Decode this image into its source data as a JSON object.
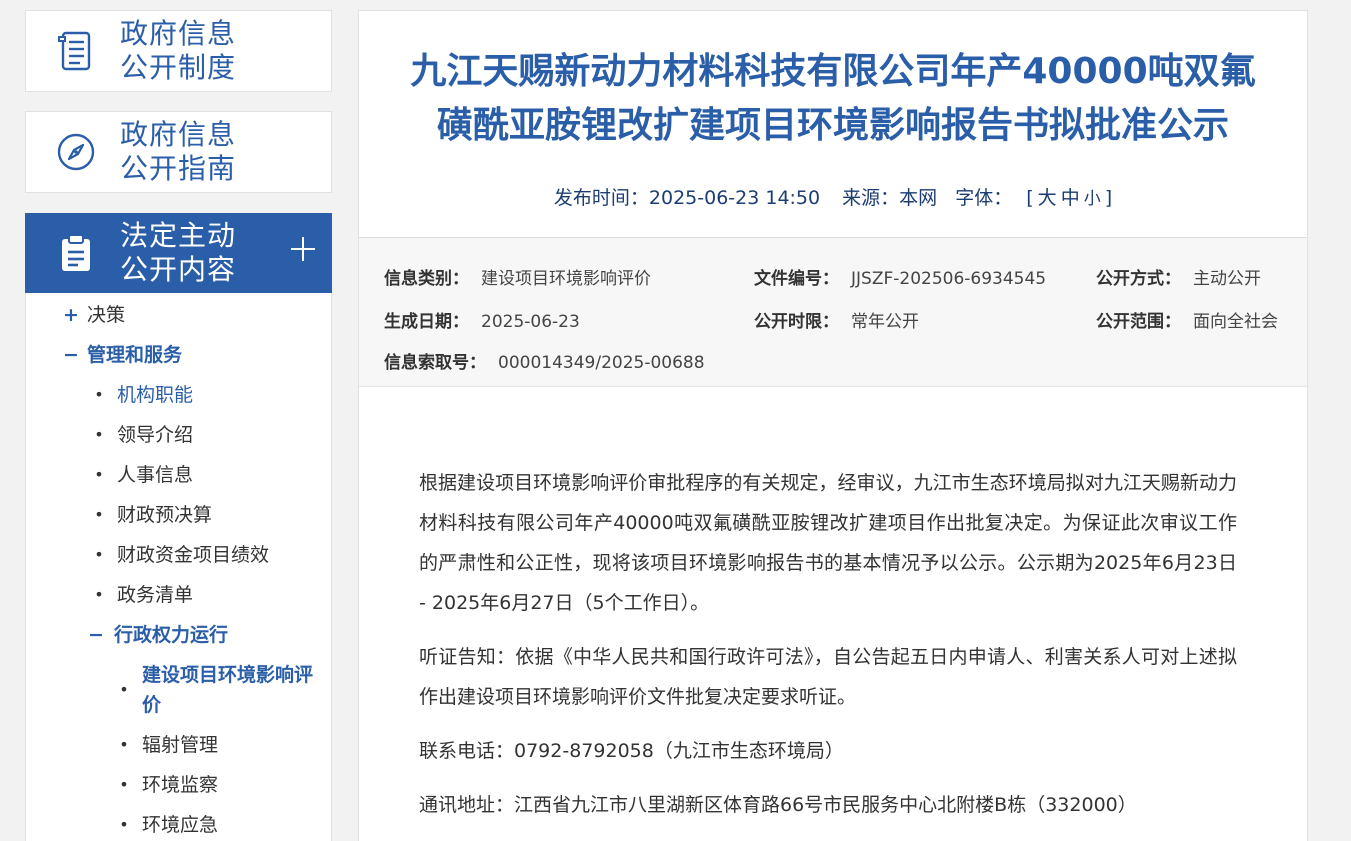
{
  "sidebar": {
    "box1": {
      "icon": "document-list-icon",
      "line1": "政府信息",
      "line2": "公开制度"
    },
    "box2": {
      "icon": "compass-icon",
      "line1": "政府信息",
      "line2": "公开指南"
    },
    "box3": {
      "icon": "clipboard-icon",
      "line1": "法定主动",
      "line2": "公开内容",
      "toggle": "plus-icon"
    },
    "tree": {
      "decision": {
        "marker": "+",
        "label": "决策"
      },
      "mgmt": {
        "marker": "−",
        "label": "管理和服务"
      },
      "mgmt_items": [
        "机构职能",
        "领导介绍",
        "人事信息",
        "财政预决算",
        "财政资金项目绩效",
        "政务清单"
      ],
      "admin": {
        "marker": "−",
        "label": "行政权力运行"
      },
      "admin_items": [
        "建设项目环境影响评价",
        "辐射管理",
        "环境监察",
        "环境应急"
      ],
      "bullet": "•"
    }
  },
  "article": {
    "title_line1": "九江天赐新动力材料科技有限公司年产40000吨双氟",
    "title_line2": "磺酰亚胺锂改扩建项目环境影响报告书拟批准公示",
    "meta": {
      "publish_label": "发布时间：",
      "publish_time": "2025-06-23 14:50",
      "source_label": "来源：",
      "source": "本网",
      "font_label": "字体：",
      "bracket_open": "[",
      "font_large": "大",
      "font_medium": "中",
      "font_small": "小",
      "bracket_close": "]"
    },
    "info": {
      "category_label": "信息类别：",
      "category": "建设项目环境影响评价",
      "doc_no_label": "文件编号：",
      "doc_no": "JJSZF-202506-6934545",
      "open_mode_label": "公开方式：",
      "open_mode": "主动公开",
      "date_label": "生成日期：",
      "date": "2025-06-23",
      "open_period_label": "公开时限：",
      "open_period": "常年公开",
      "open_scope_label": "公开范围：",
      "open_scope": "面向全社会",
      "index_label": "信息索取号：",
      "index_no": "000014349/2025-00688"
    },
    "paragraphs": [
      "根据建设项目环境影响评价审批程序的有关规定，经审议，九江市生态环境局拟对九江天赐新动力材料科技有限公司年产40000吨双氟磺酰亚胺锂改扩建项目作出批复决定。为保证此次审议工作的严肃性和公正性，现将该项目环境影响报告书的基本情况予以公示。公示期为2025年6月23日 - 2025年6月27日（5个工作日）。",
      "听证告知：依据《中华人民共和国行政许可法》，自公告起五日内申请人、利害关系人可对上述拟作出建设项目环境影响评价文件批复决定要求听证。",
      "联系电话：0792-8792058（九江市生态环境局）",
      "通讯地址：江西省九江市八里湖新区体育路66号市民服务中心北附楼B栋（332000）"
    ]
  },
  "colors": {
    "accent": "#2b5ea8",
    "meta_text": "#1c3d72"
  }
}
